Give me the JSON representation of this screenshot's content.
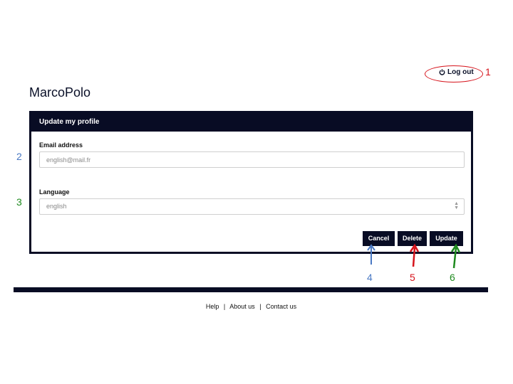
{
  "header": {
    "logout_label": "Log out",
    "app_title": "MarcoPolo"
  },
  "panel": {
    "title": "Update my profile",
    "email_label": "Email address",
    "email_placeholder": "english@mail.fr",
    "language_label": "Language",
    "language_value": "english",
    "buttons": {
      "cancel": "Cancel",
      "delete": "Delete",
      "update": "Update"
    }
  },
  "footer": {
    "links": [
      "Help",
      "About us",
      "Contact us"
    ],
    "separator": "|"
  },
  "annotations": {
    "numbers": [
      "1",
      "2",
      "3",
      "4",
      "5",
      "6"
    ],
    "colors": {
      "red": "#d6131b",
      "blue": "#4a79c4",
      "green": "#1e8a1e"
    }
  },
  "colors": {
    "navy": "#080c24"
  }
}
